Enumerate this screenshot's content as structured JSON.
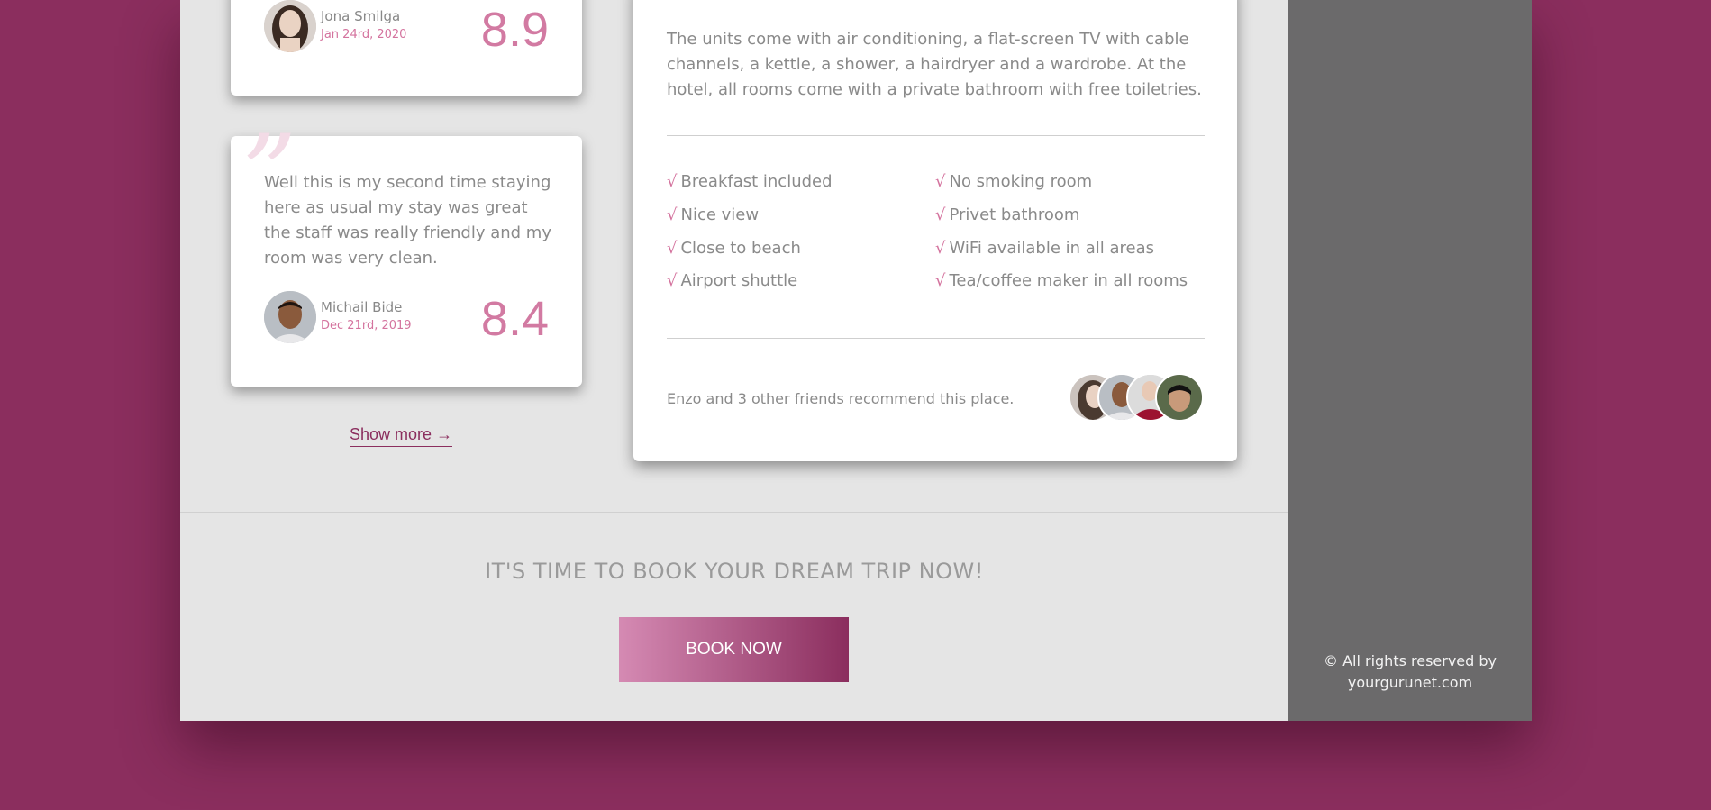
{
  "reviews": [
    {
      "name": "Jona Smilga",
      "date": "Jan 24rd, 2020",
      "score": "8.9"
    },
    {
      "quote_mark": "”",
      "text": "Well this is my second time staying here as usual my stay was great the staff was really friendly and my room was very clean.",
      "name": "Michail Bide",
      "date": "Dec 21rd, 2019",
      "score": "8.4"
    }
  ],
  "show_more": {
    "label": "Show more",
    "arrow": "→"
  },
  "details": {
    "description": "The units come with air conditioning, a flat-screen TV with cable channels, a kettle, a shower, a hairdryer and a wardrobe. At the hotel, all rooms come with a private bathroom with free toiletries.",
    "check_glyph": "√",
    "amenities_left": [
      "Breakfast included",
      "Nice view",
      "Close to beach",
      "Airport shuttle"
    ],
    "amenities_right": [
      "No smoking room",
      "Privet bathroom",
      "WiFi available in all areas",
      "Tea/coffee maker in all rooms"
    ],
    "recommend_text": "Enzo and 3 other friends recommend this place."
  },
  "cta": {
    "title": "IT'S TIME TO BOOK YOUR DREAM TRIP NOW!",
    "button_label": "BOOK NOW"
  },
  "footer": {
    "copyright_line1": "© All rights reserved by",
    "copyright_line2": "yourgurunet.com"
  },
  "colors": {
    "brand": "#8b2e5e",
    "accent_pink": "#d4739e",
    "sidebar": "#6b6a6b",
    "main_bg": "#e5e5e5"
  }
}
